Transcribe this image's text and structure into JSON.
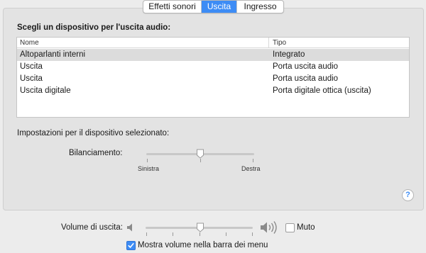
{
  "tabs": [
    {
      "label": "Effetti sonori",
      "active": false
    },
    {
      "label": "Uscita",
      "active": true
    },
    {
      "label": "Ingresso",
      "active": false
    }
  ],
  "output": {
    "section_title": "Scegli un dispositivo per l'uscita audio:",
    "columns": [
      "Nome",
      "Tipo"
    ],
    "devices": [
      {
        "name": "Altoparlanti interni",
        "type": "Integrato",
        "selected": true
      },
      {
        "name": "Uscita",
        "type": "Porta uscita audio",
        "selected": false
      },
      {
        "name": "Uscita",
        "type": "Porta uscita audio",
        "selected": false
      },
      {
        "name": "Uscita digitale",
        "type": "Porta digitale ottica (uscita)",
        "selected": false
      }
    ]
  },
  "settings": {
    "title": "Impostazioni per il dispositivo selezionato:",
    "balance_label": "Bilanciamento:",
    "balance_left": "Sinistra",
    "balance_right": "Destra",
    "balance_value": 0.5
  },
  "volume": {
    "label": "Volume di uscita:",
    "value": 0.5,
    "mute_label": "Muto",
    "mute_checked": false,
    "show_in_menu_label": "Mostra volume nella barra dei menu",
    "show_in_menu_checked": true
  },
  "help_label": "?",
  "colors": {
    "accent": "#3d8cf5",
    "selected_row": "#dcdcdc"
  }
}
